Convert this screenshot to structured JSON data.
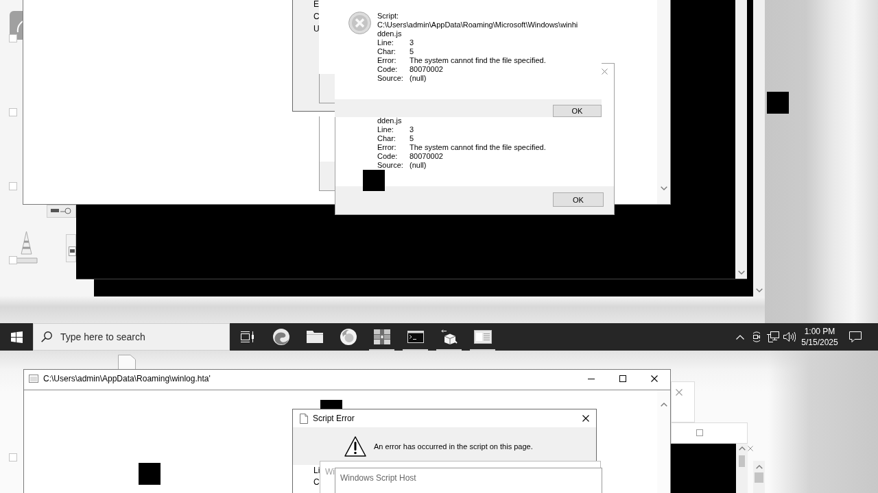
{
  "desktop_icons": [
    {
      "kind": "app",
      "checked": false
    },
    {
      "kind": "blank",
      "checked": false
    },
    {
      "kind": "blank",
      "checked": false
    },
    {
      "kind": "cone",
      "checked": false
    }
  ],
  "back_dialog": {
    "labels": [
      "E",
      "C",
      "U"
    ]
  },
  "wsh_dialogs": [
    {
      "script_label": "Script:",
      "script_path": [
        "C:\\Users\\admin\\AppData\\Roaming\\Microsoft\\Windows\\winhi",
        "dden.js"
      ],
      "fields": [
        {
          "label": "Line:",
          "value": "3"
        },
        {
          "label": "Char:",
          "value": "5"
        },
        {
          "label": "Error:",
          "value": "The system cannot find the file specified."
        },
        {
          "label": "Code:",
          "value": "80070002"
        },
        {
          "label": "Source:",
          "value": "(null)"
        }
      ],
      "button": "OK"
    },
    {
      "script_path": [
        "dden.js"
      ],
      "fields": [
        {
          "label": "Line:",
          "value": "3"
        },
        {
          "label": "Char:",
          "value": "5"
        },
        {
          "label": "Error:",
          "value": "The system cannot find the file specified."
        },
        {
          "label": "Code:",
          "value": "80070002"
        },
        {
          "label": "Source:",
          "value": "(null)"
        }
      ],
      "button": "OK"
    }
  ],
  "taskbar": {
    "search": {
      "placeholder": "Type here to search"
    },
    "apps": [
      {
        "kind": "task-view",
        "running": false
      },
      {
        "kind": "swirl",
        "running": false
      },
      {
        "kind": "folder",
        "running": false
      },
      {
        "kind": "flame-globe",
        "running": false
      },
      {
        "kind": "books",
        "running": true
      },
      {
        "kind": "terminal",
        "running": true
      },
      {
        "kind": "package",
        "running": true
      },
      {
        "kind": "form",
        "running": true
      }
    ],
    "clock": {
      "time": "1:00 PM",
      "date": "5/15/2025"
    }
  },
  "lower_desktop_icons": [
    {
      "checked": false
    }
  ],
  "hta_window": {
    "title": "C:\\Users\\admin\\AppData\\Roaming\\winlog.hta'"
  },
  "script_error_dialog": {
    "title": "Script Error",
    "message": "An error has occurred in the script on this page.",
    "labels": [
      "Li",
      "C"
    ]
  },
  "partial_dialog": {
    "title": "Wi"
  },
  "wsh_title_dialog": {
    "title": "Windows Script Host"
  }
}
